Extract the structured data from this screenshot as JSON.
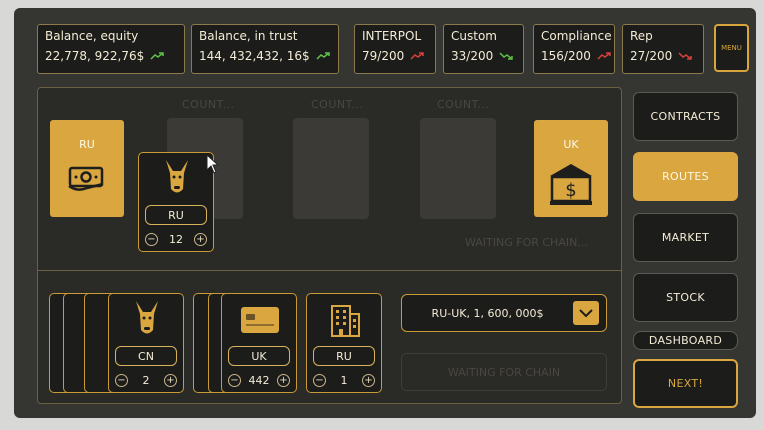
{
  "stats": [
    {
      "label": "Balance, equity",
      "value": "22,778, 922,76$",
      "trend": "up",
      "trend_color": "#5fc24a"
    },
    {
      "label": "Balance, in trust",
      "value": "144, 432,432, 16$",
      "trend": "up",
      "trend_color": "#5fc24a"
    },
    {
      "label": "INTERPOL",
      "value": "79/200",
      "trend": "up",
      "trend_color": "#d8403a"
    },
    {
      "label": "Custom",
      "value": "33/200",
      "trend": "down",
      "trend_color": "#5fc24a"
    },
    {
      "label": "Compliance",
      "value": "156/200",
      "trend": "up",
      "trend_color": "#d8403a"
    },
    {
      "label": "Rep",
      "value": "27/200",
      "trend": "down",
      "trend_color": "#d8403a"
    }
  ],
  "menu_label": "MENU",
  "board": {
    "origin": {
      "code": "RU",
      "icon": "money-icon"
    },
    "destination": {
      "code": "UK",
      "icon": "bank-icon"
    },
    "slot_labels": [
      "COUNT...",
      "COUNT...",
      "COUNT..."
    ],
    "waiting_text": "WAITING FOR CHAIN...",
    "dragged_card": {
      "icon": "donkey-icon",
      "tag": "RU",
      "count": "12"
    }
  },
  "inventory": [
    {
      "icon": "donkey-icon",
      "tag": "CN",
      "count": "2"
    },
    {
      "icon": "credit-card-icon",
      "tag": "UK",
      "count": "442"
    },
    {
      "icon": "office-building-icon",
      "tag": "RU",
      "count": "1"
    }
  ],
  "route_select": {
    "value": "RU-UK, 1, 600, 000$"
  },
  "chain_status": "WAITING FOR CHAIN",
  "nav": [
    {
      "label": "CONTRACTS",
      "active": false
    },
    {
      "label": "ROUTES",
      "active": true
    },
    {
      "label": "MARKET",
      "active": false
    },
    {
      "label": "STOCK",
      "active": false
    },
    {
      "label": "DASHBOARD",
      "active": false
    }
  ],
  "next_label": "NEXT!",
  "colors": {
    "accent": "#d9a640",
    "panel": "#1c1c1a",
    "background": "#353532"
  }
}
